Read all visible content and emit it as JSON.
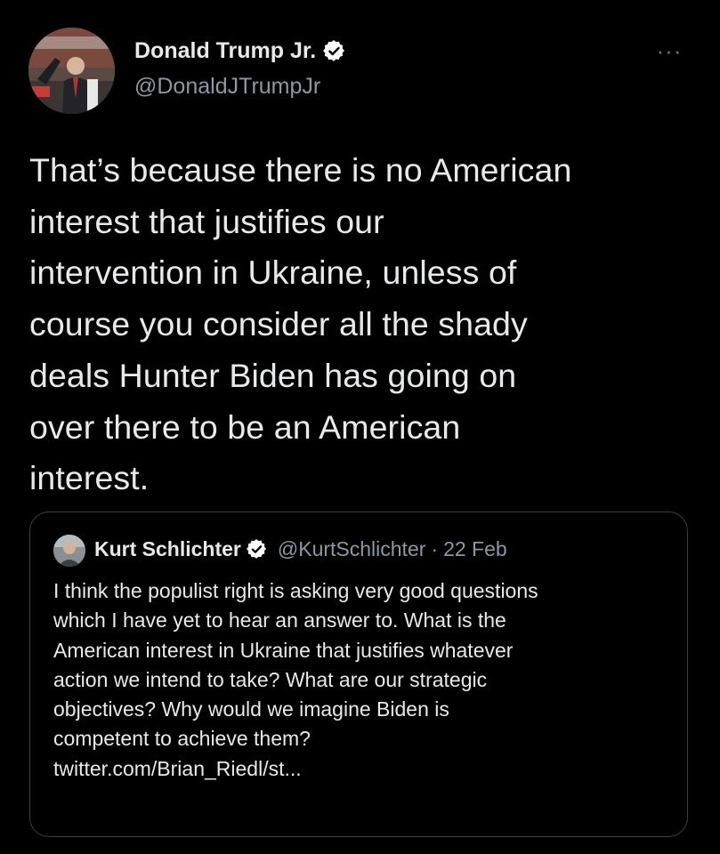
{
  "tweet": {
    "author": {
      "name": "Donald Trump Jr.",
      "handle": "@DonaldJTrumpJr",
      "verified": true
    },
    "more_label": "···",
    "text": "That’s because there is no American\ninterest that justifies our\nintervention in Ukraine, unless of\ncourse you consider all the shady\ndeals Hunter Biden has going on\nover there to be an American\ninterest."
  },
  "quoted": {
    "author": {
      "name": "Kurt Schlichter",
      "handle": "@KurtSchlichter",
      "verified": true
    },
    "separator": "·",
    "date": "22 Feb",
    "text": "I think the populist right is asking very good questions\nwhich I have yet to hear an answer to. What is the\nAmerican interest in Ukraine that justifies whatever\naction we intend to take? What are our strategic\nobjectives? Why would we imagine Biden is\ncompetent to achieve them?\ntwitter.com/Brian_Riedl/st..."
  },
  "colors": {
    "background": "#000000",
    "primary_text": "#e7e9ea",
    "secondary_text": "#8b98a5",
    "verified_badge": "#ffffff",
    "quote_border": "#3a3f44"
  },
  "icons": {
    "verified": "verified-badge-icon",
    "more": "more-horizontal-icon"
  }
}
